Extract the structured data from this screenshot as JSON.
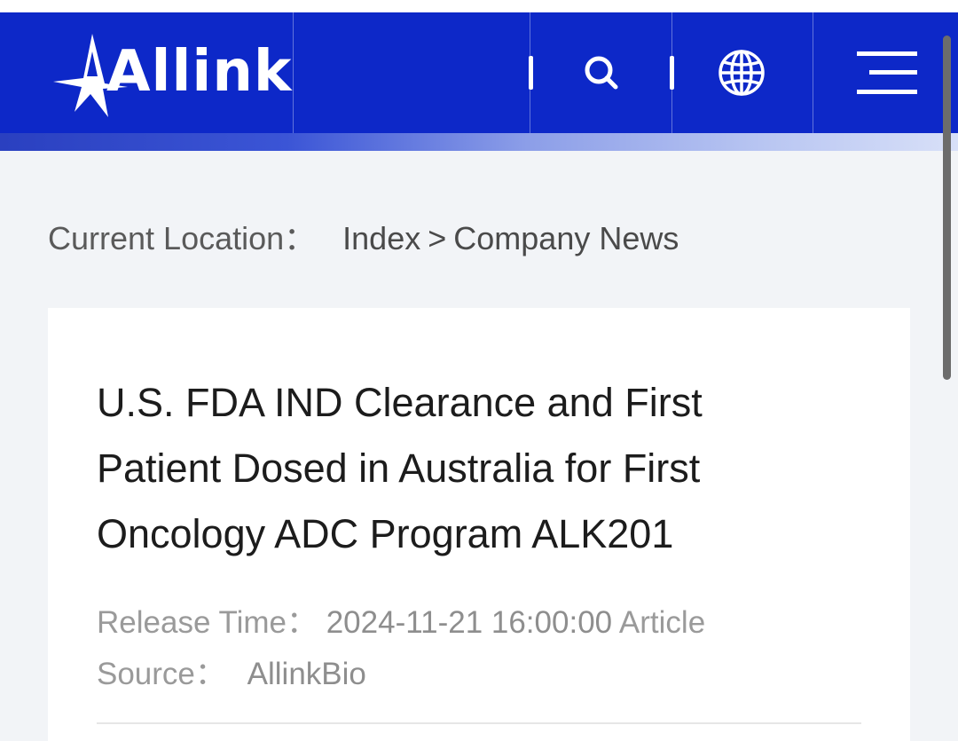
{
  "header": {
    "logo_text": "Allink",
    "icons": {
      "search": "search-icon",
      "language": "globe-icon",
      "menu": "menu-icon"
    },
    "colors": {
      "brand_blue": "#0d28c8",
      "background": "#f2f4f7"
    }
  },
  "breadcrumb": {
    "label": "Current Location：",
    "items": [
      "Index",
      "Company News"
    ],
    "separator": ">"
  },
  "article": {
    "title": "U.S. FDA IND Clearance and First Patient Dosed in Australia for First Oncology ADC Program ALK201",
    "release_time_label": "Release Time：",
    "release_time": "2024-11-21 16:00:00",
    "source_label_line1": "Article",
    "source_label_line2": "Source：",
    "source": "AllinkBio"
  }
}
